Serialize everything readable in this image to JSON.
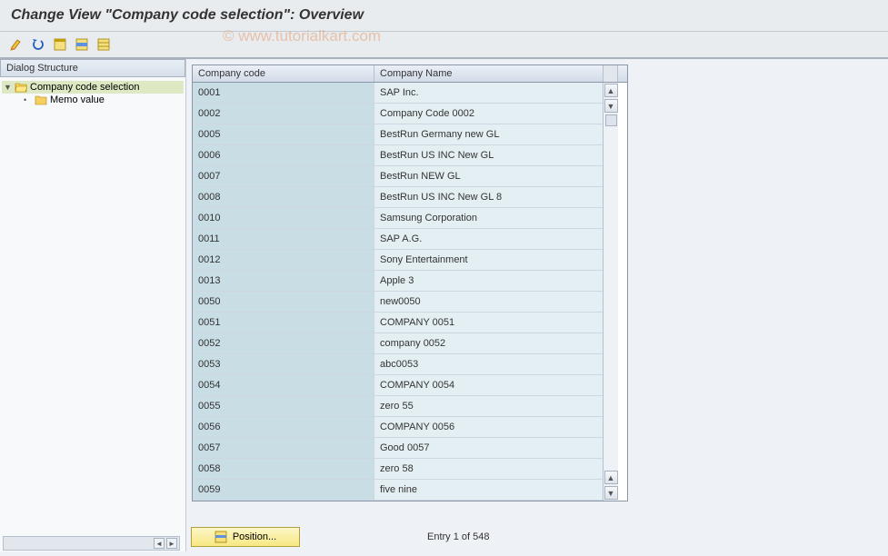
{
  "title": "Change View \"Company code selection\": Overview",
  "watermark": "© www.tutorialkart.com",
  "tree": {
    "header": "Dialog Structure",
    "nodes": [
      {
        "label": "Company code selection",
        "level": 0,
        "selected": true,
        "expandable": true,
        "open": true
      },
      {
        "label": "Memo value",
        "level": 1,
        "selected": false,
        "expandable": false
      }
    ]
  },
  "grid": {
    "headers": {
      "code": "Company code",
      "name": "Company Name"
    },
    "rows": [
      {
        "code": "0001",
        "name": "SAP Inc."
      },
      {
        "code": "0002",
        "name": "Company Code 0002"
      },
      {
        "code": "0005",
        "name": "BestRun Germany new GL"
      },
      {
        "code": "0006",
        "name": "BestRun US INC New GL"
      },
      {
        "code": "0007",
        "name": "BestRun NEW GL"
      },
      {
        "code": "0008",
        "name": "BestRun US INC New GL 8"
      },
      {
        "code": "0010",
        "name": "Samsung Corporation"
      },
      {
        "code": "0011",
        "name": "SAP A.G."
      },
      {
        "code": "0012",
        "name": "Sony Entertainment"
      },
      {
        "code": "0013",
        "name": "Apple 3"
      },
      {
        "code": "0050",
        "name": "new0050"
      },
      {
        "code": "0051",
        "name": "COMPANY 0051"
      },
      {
        "code": "0052",
        "name": "company 0052"
      },
      {
        "code": "0053",
        "name": "abc0053"
      },
      {
        "code": "0054",
        "name": "COMPANY 0054"
      },
      {
        "code": "0055",
        "name": "zero 55"
      },
      {
        "code": "0056",
        "name": "COMPANY 0056"
      },
      {
        "code": "0057",
        "name": "Good 0057"
      },
      {
        "code": "0058",
        "name": "zero 58"
      },
      {
        "code": "0059",
        "name": "five nine"
      }
    ]
  },
  "footer": {
    "position_label": "Position...",
    "entry_status": "Entry 1 of 548"
  }
}
